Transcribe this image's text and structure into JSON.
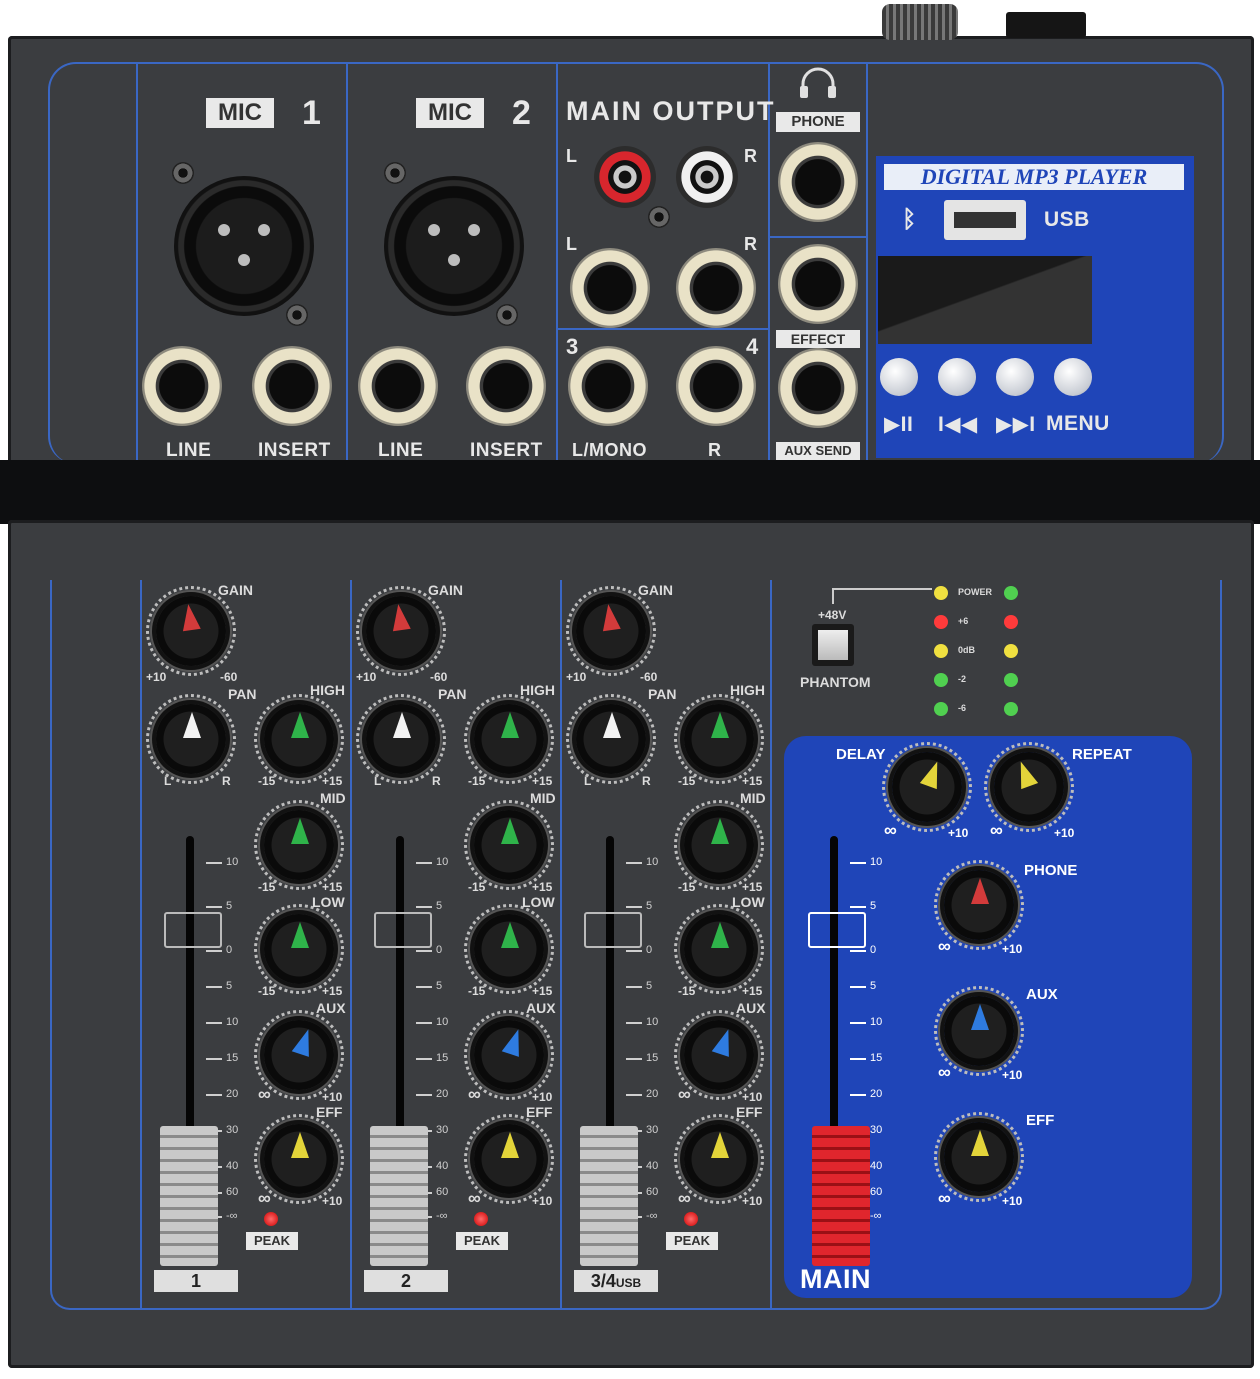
{
  "mic1": {
    "badge": "MIC",
    "num": "1"
  },
  "mic2": {
    "badge": "MIC",
    "num": "2"
  },
  "main_output": {
    "title": "MAIN OUTPUT",
    "l": "L",
    "r": "R",
    "l2": "L",
    "r2": "R",
    "n3": "3",
    "n4": "4"
  },
  "jack_labels": {
    "line1": "LINE",
    "insert1": "INSERT",
    "line2": "LINE",
    "insert2": "INSERT",
    "lmono": "L/MONO",
    "r": "R"
  },
  "phone_section": {
    "phone": "PHONE",
    "effect": "EFFECT",
    "aux_send": "AUX SEND"
  },
  "mp3": {
    "title": "DIGITAL MP3 PLAYER",
    "usb": "USB",
    "bluetooth": "ᛒ",
    "buttons": [
      "▶II",
      "I◀◀",
      "▶▶I",
      "MENU"
    ]
  },
  "channel": {
    "gain": "GAIN",
    "pan": "PAN",
    "high": "HIGH",
    "mid": "MID",
    "low": "LOW",
    "aux": "AUX",
    "eff": "EFF",
    "plus10": "+10",
    "minus60": "-60",
    "l": "L",
    "r": "R",
    "minus15": "-15",
    "plus15": "+15",
    "inf": "∞",
    "peak": "PEAK"
  },
  "fader_scale": [
    "10",
    "5",
    "0",
    "5",
    "10",
    "15",
    "20",
    "30",
    "40",
    "60",
    "-∞"
  ],
  "channel_names": [
    "1",
    "2",
    "3/4",
    "USB"
  ],
  "phantom": {
    "v": "+48V",
    "label": "PHANTOM"
  },
  "meter": {
    "labels": [
      "POWER",
      "+6",
      "0dB",
      "-2",
      "-6"
    ]
  },
  "master": {
    "delay": "DELAY",
    "repeat": "REPEAT",
    "phone": "PHONE",
    "aux": "AUX",
    "eff": "EFF",
    "inf": "∞",
    "plus10": "+10",
    "main": "MAIN"
  },
  "colors": {
    "panel": "#3b3d40",
    "accent_line": "#3a67c4",
    "master_blue": "#1f45b8",
    "gain_ptr": "#d33b3b",
    "pan_ptr": "#f2f2f2",
    "eq_ptr": "#2fb34a",
    "aux_ptr": "#2e7be0",
    "eff_ptr": "#e3d43a"
  }
}
